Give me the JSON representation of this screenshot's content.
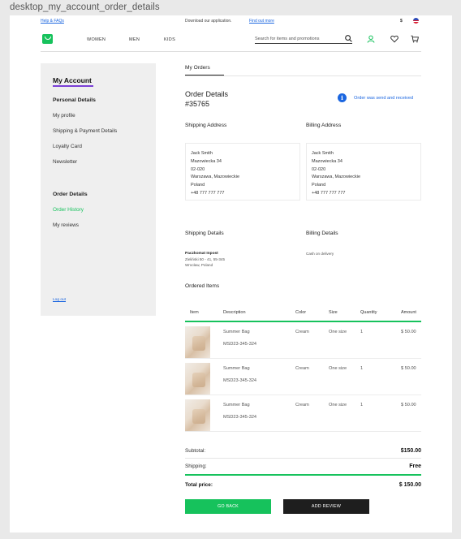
{
  "frame_label": "desktop_my_account_order_details",
  "topbar": {
    "help": "Help & FAQs",
    "download": "Download our application.",
    "find_out": "Find out more",
    "currency": "$"
  },
  "nav": {
    "links": [
      "WOMEN",
      "MEN",
      "KIDS"
    ],
    "search_placeholder": "Search for items and promotions"
  },
  "sidebar": {
    "title": "My Account",
    "personal_heading": "Personal Details",
    "personal_items": [
      "My profile",
      "Shipping & Payment Details",
      "Loyalty Card",
      "Newsletter"
    ],
    "order_heading": "Order Details",
    "order_items": [
      "Order History",
      "My reviews"
    ],
    "logout": "Log out"
  },
  "main": {
    "tab": "My Orders",
    "order_title_line1": "Order Details",
    "order_title_line2": "#35765",
    "status": "Order was send and received",
    "shipping_address_heading": "Shipping Address",
    "billing_address_heading": "Billing Address",
    "shipping_address": [
      "Jack Smith",
      "Mazowiecka 34",
      "02-020",
      "Warszawa, Mazowieckie",
      "Poland",
      "+48 777 777 777"
    ],
    "billing_address": [
      "Jack Smith",
      "Mazowiecka 34",
      "02-020",
      "Warszawa, Mazowieckie",
      "Poland",
      "+48 777 777 777"
    ],
    "shipping_details_heading": "Shipping Details",
    "billing_details_heading": "Billing Details",
    "shipping_method": "Paczkomat Inpost",
    "shipping_lines": [
      "Zieliński 50 - 41, 55-345",
      "Wrocław, Poland"
    ],
    "billing_method": "Cash on delivery",
    "ordered_items_heading": "Ordered Items",
    "table_headers": [
      "Item",
      "Description",
      "Color",
      "Size",
      "Quantity",
      "Amount"
    ],
    "items": [
      {
        "name": "Summer Bag",
        "code": "MSD23-345-324",
        "color": "Cream",
        "size": "One size",
        "qty": "1",
        "amount": "$ 50.00"
      },
      {
        "name": "Summer Bag",
        "code": "MSD23-345-324",
        "color": "Cream",
        "size": "One size",
        "qty": "1",
        "amount": "$ 50.00"
      },
      {
        "name": "Summer Bag",
        "code": "MSD23-345-324",
        "color": "Cream",
        "size": "One size",
        "qty": "1",
        "amount": "$ 50.00"
      }
    ],
    "subtotal_label": "Subtotal:",
    "subtotal_value": "$150.00",
    "shipping_label": "Shipping:",
    "shipping_value": "Free",
    "total_label": "Total price:",
    "total_value": "$ 150.00",
    "go_back": "GO BACK",
    "add_review": "ADD REVIEW"
  },
  "colors": {
    "accent": "#16c25c",
    "link": "#1b66e0",
    "dark": "#1e1e1e",
    "sidebar_underline": "#7a3fd6"
  }
}
